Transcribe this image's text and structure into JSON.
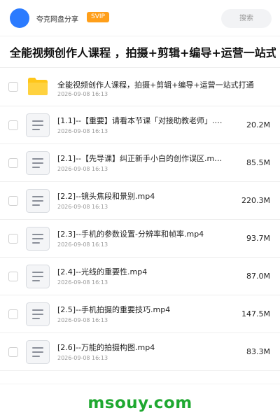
{
  "header": {
    "share_name": "夸克网盘分享",
    "badge": "SVIP",
    "search_placeholder": "搜索",
    "avatar_color": "#2b7bff"
  },
  "page_title": "全能视频创作人课程 ，拍摄+剪辑+编导+运营一站式打通",
  "files": [
    {
      "type": "folder",
      "icon": "folder-icon",
      "name": "全能视频创作人课程，拍摄+剪辑+编导+运营一站式打通",
      "date": "2026-09-08 16:13",
      "size": ""
    },
    {
      "type": "file",
      "icon": "file-icon",
      "name": "[1.1]--【重要】请看本节课「对接助教老师」.…",
      "date": "2026-09-08 16:13",
      "size": "20.2M"
    },
    {
      "type": "file",
      "icon": "file-icon",
      "name": "[2.1]--【先导课】纠正新手小白的创作误区.m…",
      "date": "2026-09-08 16:13",
      "size": "85.5M"
    },
    {
      "type": "file",
      "icon": "file-icon",
      "name": "[2.2]--镜头焦段和景别.mp4",
      "date": "2026-09-08 16:13",
      "size": "220.3M"
    },
    {
      "type": "file",
      "icon": "file-icon",
      "name": "[2.3]--手机的参数设置-分辨率和帧率.mp4",
      "date": "2026-09-08 16:13",
      "size": "93.7M"
    },
    {
      "type": "file",
      "icon": "file-icon",
      "name": "[2.4]--光线的重要性.mp4",
      "date": "2026-09-08 16:13",
      "size": "87.0M"
    },
    {
      "type": "file",
      "icon": "file-icon",
      "name": "[2.5]--手机拍摄的重要技巧.mp4",
      "date": "2026-09-08 16:13",
      "size": "147.5M"
    },
    {
      "type": "file",
      "icon": "file-icon",
      "name": "[2.6]--万能的拍摄构图.mp4",
      "date": "2026-09-08 16:13",
      "size": "83.3M"
    }
  ],
  "watermark": "msouy.com",
  "colors": {
    "accent": "#2b7bff",
    "badge": "#ff9f1a",
    "folder": "#ffc61a",
    "watermark": "#1fa830"
  }
}
